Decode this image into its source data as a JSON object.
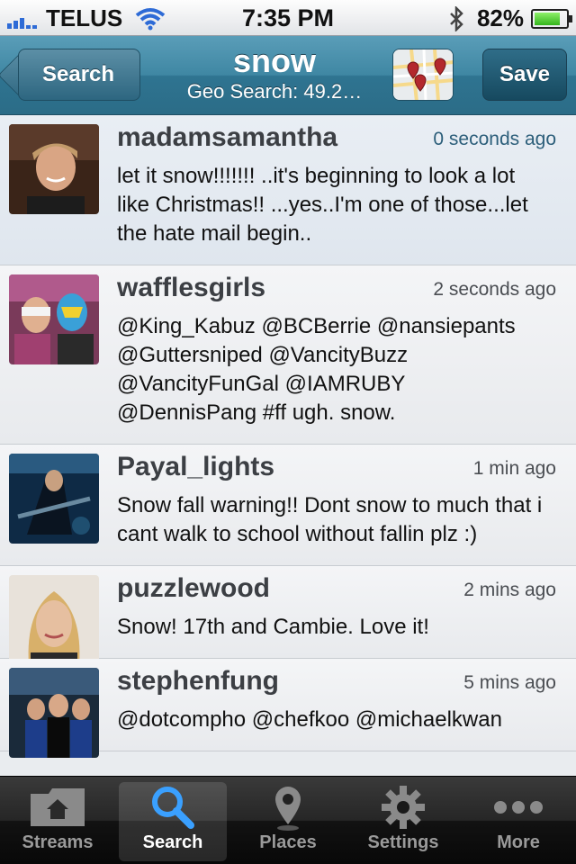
{
  "status_bar": {
    "carrier": "TELUS",
    "time": "7:35 PM",
    "battery": "82%",
    "battery_level": 0.82
  },
  "nav": {
    "back_label": "Search",
    "title": "snow",
    "subtitle": "Geo Search: 49.2…",
    "map_icon": "map-icon",
    "save_label": "Save"
  },
  "tweets": [
    {
      "user": "madamsamantha",
      "time": "0 seconds ago",
      "text": "let it snow!!!!!!! ..it's beginning to look a lot like Christmas!! ...yes..I'm one of those...let the hate mail begin.."
    },
    {
      "user": "wafflesgirls",
      "time": "2 seconds ago",
      "text": "@King_Kabuz @BCBerrie @nansiepants @Guttersniped @VancityBuzz @VancityFunGal @IAMRUBY @DennisPang #ff ugh. snow."
    },
    {
      "user": "Payal_lights",
      "time": "1 min ago",
      "text": "Snow fall warning!! Dont snow to much that i cant walk to school without fallin plz :)"
    },
    {
      "user": "puzzlewood",
      "time": "2 mins ago",
      "text": "Snow! 17th and Cambie. Love it!"
    },
    {
      "user": "stephenfung",
      "time": "5 mins ago",
      "text": "@dotcompho @chefkoo @michaelkwan"
    }
  ],
  "tabs": [
    {
      "label": "Streams",
      "icon": "folder-home-icon"
    },
    {
      "label": "Search",
      "icon": "search-icon",
      "active": true
    },
    {
      "label": "Places",
      "icon": "map-pin-icon"
    },
    {
      "label": "Settings",
      "icon": "gear-icon"
    },
    {
      "label": "More",
      "icon": "ellipsis-icon"
    }
  ],
  "colors": {
    "nav_bar": "#3f87a3",
    "tab_bar": "#1a1a1a",
    "link_blue": "#2e6bd6"
  }
}
